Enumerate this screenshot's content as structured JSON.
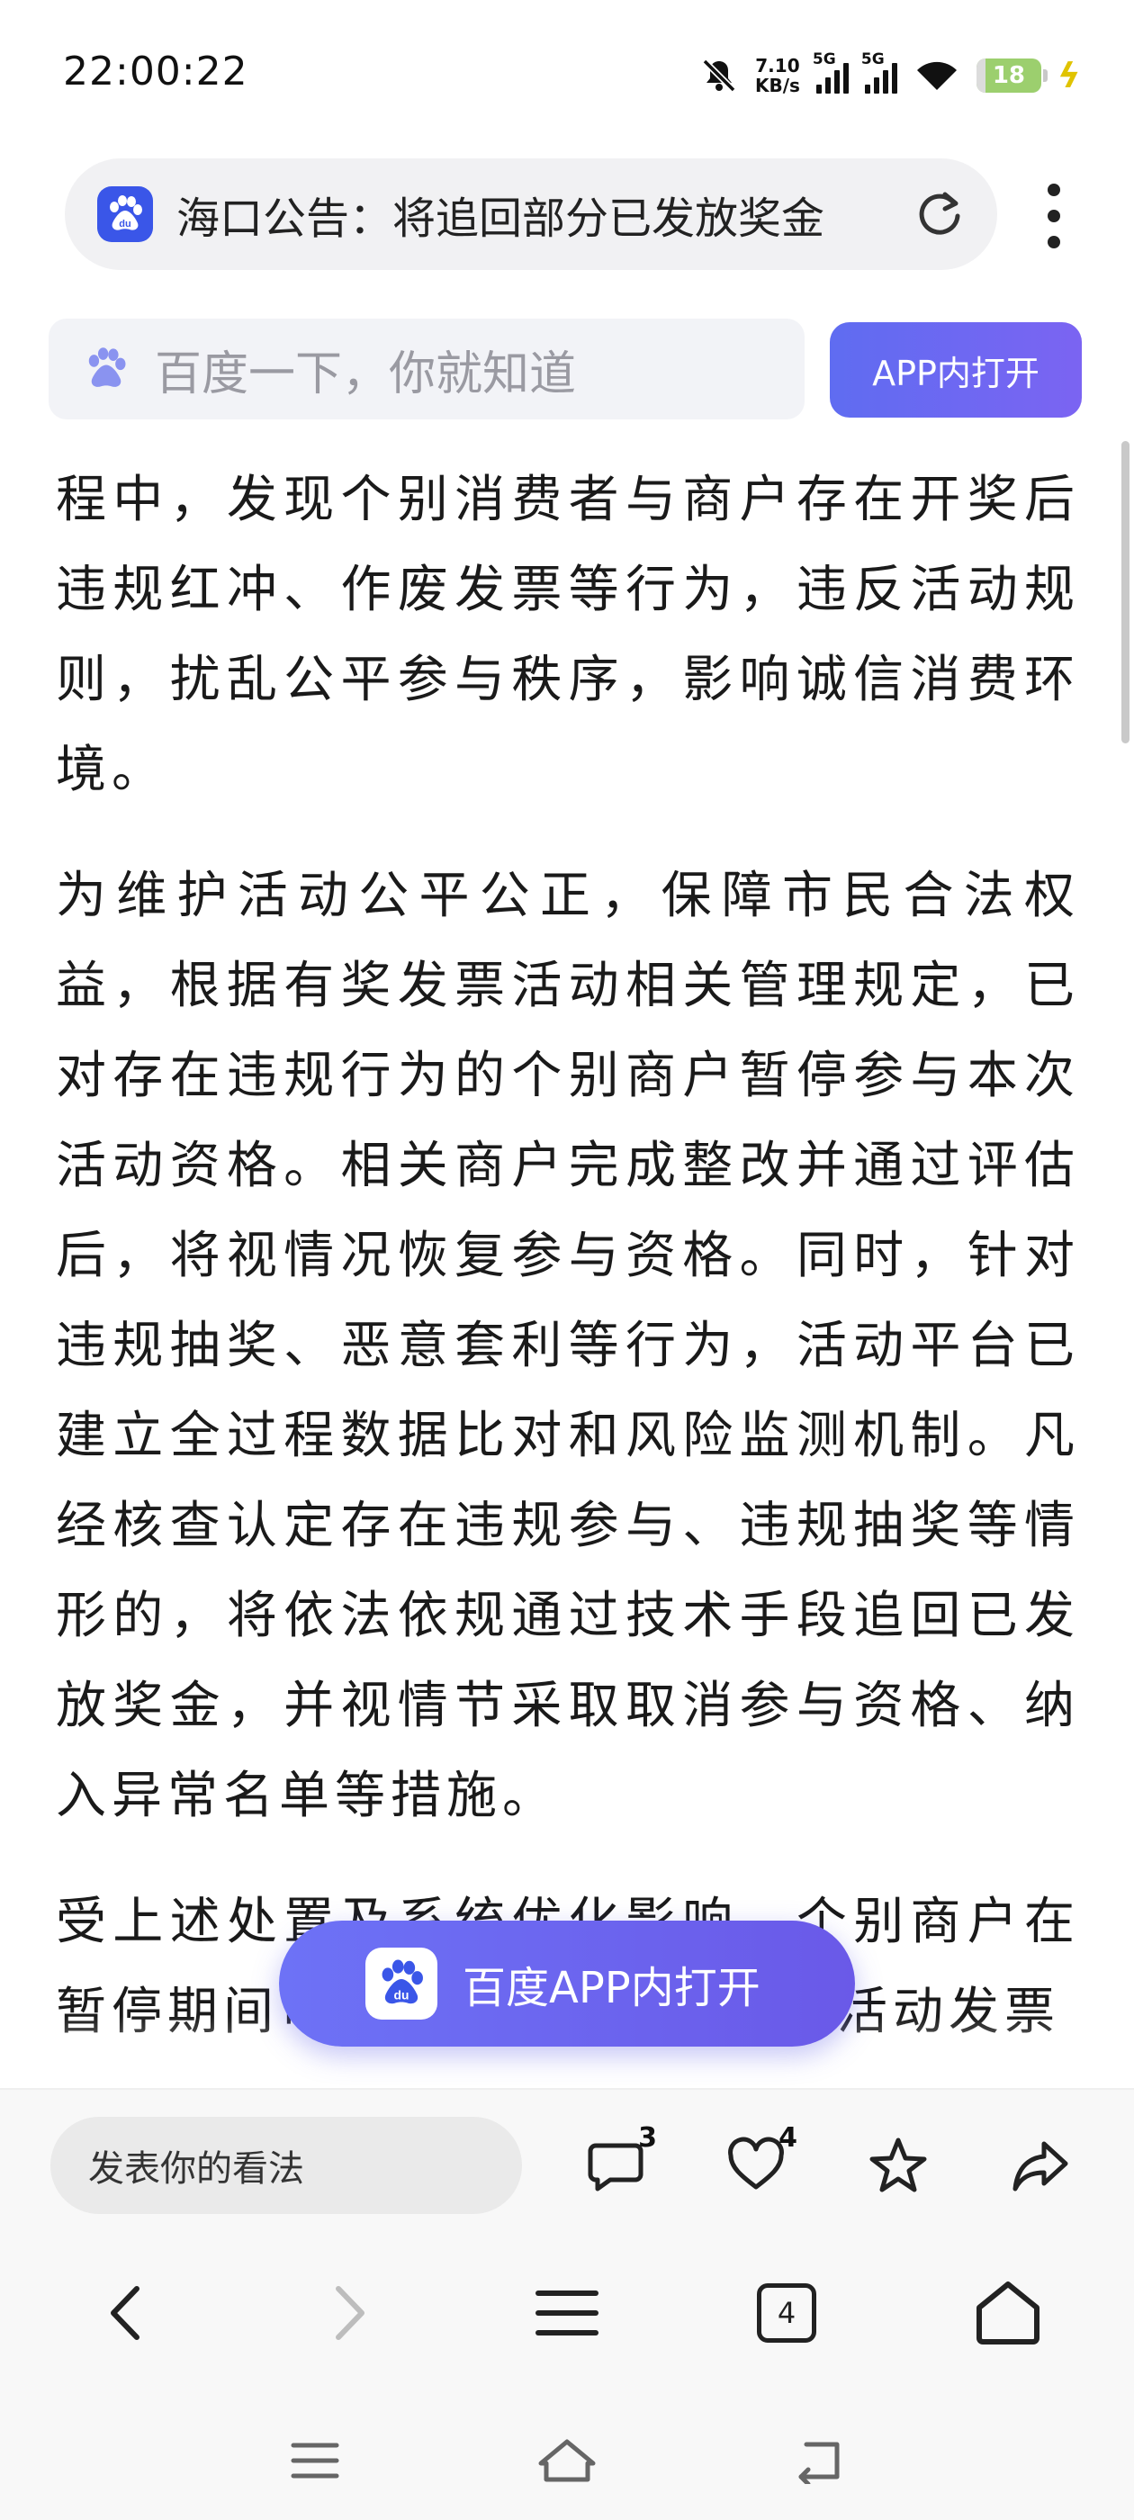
{
  "status_bar": {
    "time": "22:00:22",
    "net_speed_value": "7.10",
    "net_speed_unit": "KB/s",
    "sim1_label": "5G",
    "sim2_label": "5G",
    "battery_level": "18"
  },
  "address_bar": {
    "title": "海口公告：将追回部分已发放奖金"
  },
  "search": {
    "placeholder": "百度一下，你就知道",
    "open_app_label": "APP内打开"
  },
  "article": {
    "paragraphs": [
      "程中，发现个别消费者与商户存在开奖后违规红冲、作废发票等行为，违反活动规则，扰乱公平参与秩序，影响诚信消费环境。",
      "为维护活动公平公正，保障市民合法权益，根据有奖发票活动相关管理规定，已对存在违规行为的个别商户暂停参与本次活动资格。相关商户完成整改并通过评估后，将视情况恢复参与资格。同时，针对违规抽奖、恶意套利等行为，活动平台已建立全过程数据比对和风险监测机制。凡经核查认定存在违规参与、违规抽奖等情形的，将依法依规通过技术手段追回已发放奖金，并视情节采取取消参与资格、纳入异常名单等措施。",
      "受上述处置及系统优化影响，个别商户在暂停期间可能无法开具参与有奖活动发票"
    ]
  },
  "floating_button": {
    "label": "百度APP内打开"
  },
  "comment_bar": {
    "placeholder": "发表你的看法",
    "comment_count": "3",
    "like_count": "4"
  },
  "browser_nav": {
    "tab_count": "4"
  },
  "colors": {
    "accent": "#6a66f0",
    "brand_blue": "#3a56e8"
  }
}
